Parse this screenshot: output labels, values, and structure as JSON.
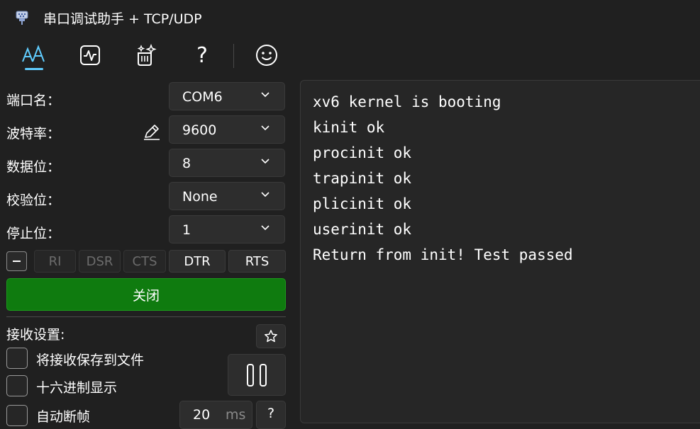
{
  "window": {
    "title": "串口调试助手 + TCP/UDP"
  },
  "toolbar": {
    "icons": [
      "font-style-icon",
      "pulse-monitor-icon",
      "sparkle-icon",
      "help-icon",
      "smiley-icon"
    ],
    "help_glyph": "?",
    "accent": "#60cdff"
  },
  "serial": {
    "port_label": "端口名：",
    "port_value": "COM6",
    "baud_label": "波特率：",
    "baud_value": "9600",
    "databits_label": "数据位：",
    "databits_value": "8",
    "parity_label": "校验位：",
    "parity_value": "None",
    "stopbits_label": "停止位：",
    "stopbits_value": "1"
  },
  "signals": {
    "ri": "RI",
    "dsr": "DSR",
    "cts": "CTS",
    "dtr": "DTR",
    "rts": "RTS"
  },
  "actions": {
    "close_label": "关闭",
    "close_color": "#0f7b0f"
  },
  "receive": {
    "title": "接收设置:",
    "save_to_file": "将接收保存到文件",
    "hex_display": "十六进制显示",
    "auto_frame": "自动断帧",
    "frame_ms_value": "20",
    "frame_ms_unit": "ms",
    "help_glyph": "?"
  },
  "terminal": {
    "lines": [
      "xv6 kernel is booting",
      "kinit ok",
      "procinit ok",
      "trapinit ok",
      "plicinit ok",
      "userinit ok",
      "Return from init! Test passed"
    ]
  }
}
